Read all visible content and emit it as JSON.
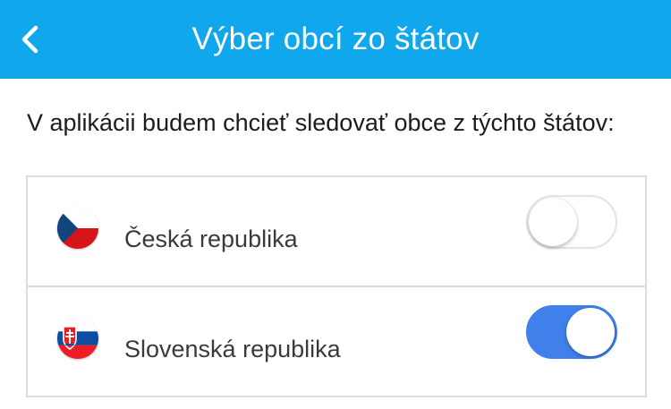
{
  "header": {
    "title": "Výber obcí zo štátov",
    "back_icon": "chevron-left-icon",
    "background_color": "#11a7ec"
  },
  "intro_text": "V aplikácii budem chcieť sledovať obce z týchto štátov:",
  "countries": [
    {
      "name": "Česká republika",
      "flag_icon": "czech-flag-icon",
      "enabled": false
    },
    {
      "name": "Slovenská republika",
      "flag_icon": "slovak-flag-icon",
      "enabled": true
    }
  ],
  "colors": {
    "toggle_on": "#3f80ea",
    "toggle_off_border": "#e3e3e3"
  }
}
